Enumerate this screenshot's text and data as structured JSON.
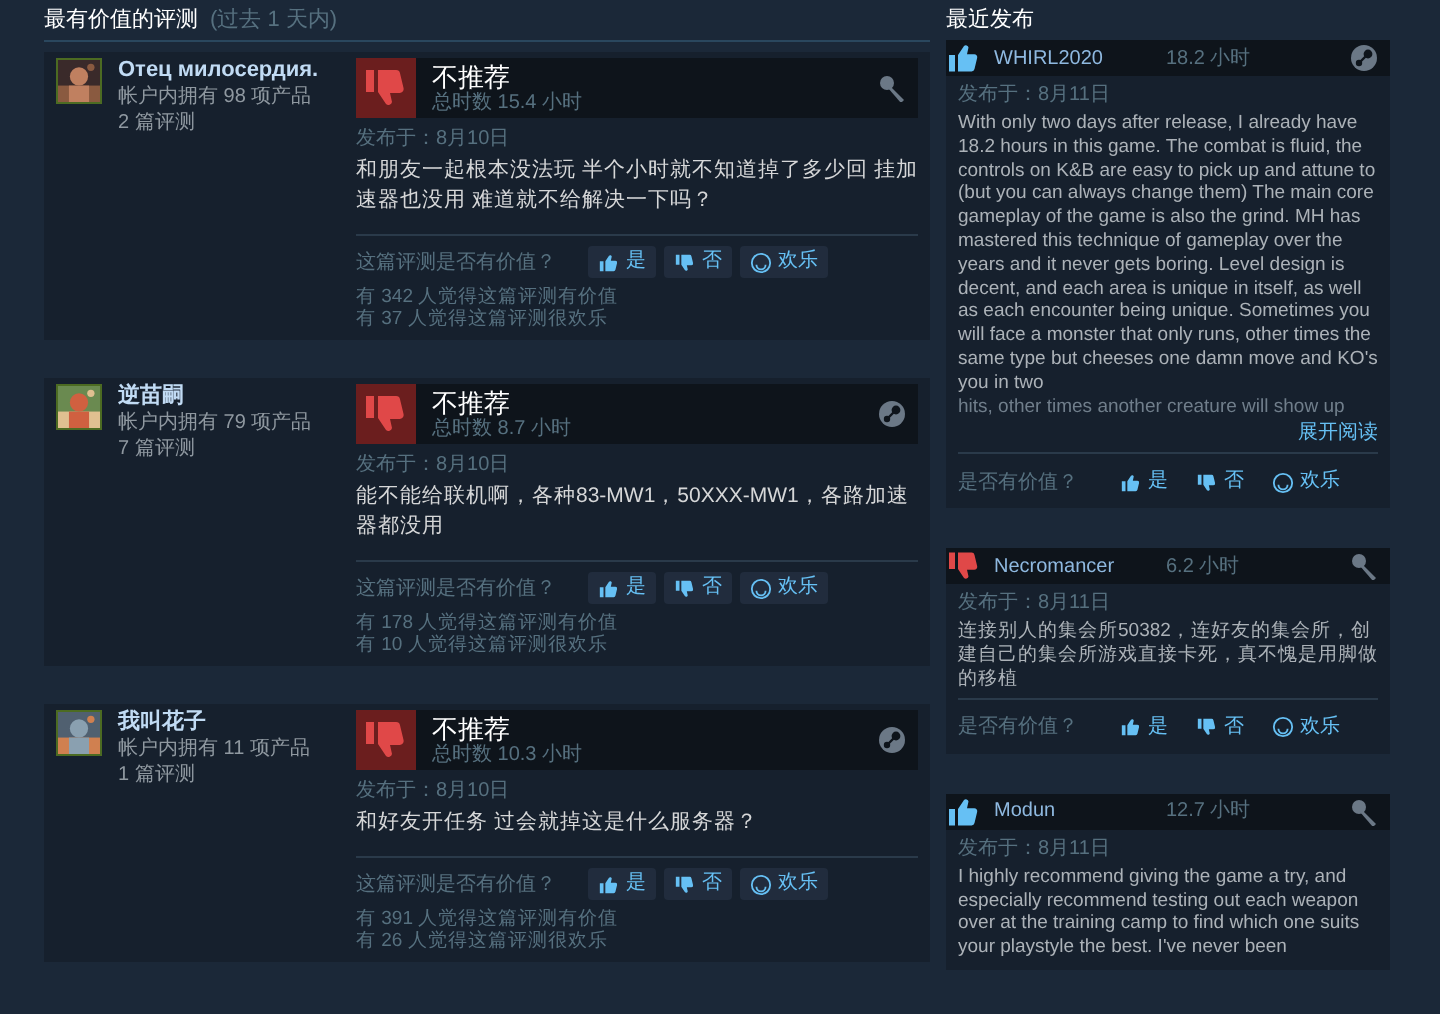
{
  "most_helpful": {
    "title": "最有价值的评测",
    "subtitle": "(过去 1 天内)",
    "reviews": [
      {
        "author": "Отец милосердия.",
        "products": "帐户内拥有 98 项产品",
        "review_count": "2 篇评测",
        "recommended": false,
        "verdict": "不推荐",
        "hours": "总时数 15.4 小时",
        "kind": "key",
        "posted": "发布于：8月10日",
        "text": "和朋友一起根本没法玩 半个小时就不知道掉了多少回 挂加速器也没用 难道就不给解决一下吗？",
        "helpful_prompt": "这篇评测是否有价值？",
        "buttons": [
          {
            "kind": "yes",
            "label": "是"
          },
          {
            "kind": "no",
            "label": "否"
          },
          {
            "kind": "funny",
            "label": "欢乐"
          }
        ],
        "helpful_count": "有 342 人觉得这篇评测有价值",
        "funny_count": "有 37 人觉得这篇评测很欢乐"
      },
      {
        "author": "逆苗嗣",
        "products": "帐户内拥有 79 项产品",
        "review_count": "7 篇评测",
        "recommended": false,
        "verdict": "不推荐",
        "hours": "总时数 8.7 小时",
        "kind": "steam",
        "posted": "发布于：8月10日",
        "text": "能不能给联机啊，各种83-MW1，50XXX-MW1，各路加速器都没用",
        "helpful_prompt": "这篇评测是否有价值？",
        "buttons": [
          {
            "kind": "yes",
            "label": "是"
          },
          {
            "kind": "no",
            "label": "否"
          },
          {
            "kind": "funny",
            "label": "欢乐"
          }
        ],
        "helpful_count": "有 178 人觉得这篇评测有价值",
        "funny_count": "有 10 人觉得这篇评测很欢乐"
      },
      {
        "author": "我叫花子",
        "products": "帐户内拥有 11 项产品",
        "review_count": "1 篇评测",
        "recommended": false,
        "verdict": "不推荐",
        "hours": "总时数 10.3 小时",
        "kind": "steam",
        "posted": "发布于：8月10日",
        "text": "和好友开任务 过会就掉这是什么服务器？",
        "helpful_prompt": "这篇评测是否有价值？",
        "buttons": [
          {
            "kind": "yes",
            "label": "是"
          },
          {
            "kind": "no",
            "label": "否"
          },
          {
            "kind": "funny",
            "label": "欢乐"
          }
        ],
        "helpful_count": "有 391 人觉得这篇评测有价值",
        "funny_count": "有 26 人觉得这篇评测很欢乐"
      }
    ]
  },
  "recent": {
    "title": "最近发布",
    "reviews": [
      {
        "author": "WHIRL2020",
        "recommended": true,
        "hours": "18.2 小时",
        "kind": "steam",
        "posted": "发布于：8月11日",
        "text": "With only two days after release, I already have 18.2 hours in this game. The combat is fluid, the controls on K&B are easy to pick up and attune to (but you can always change them) The main core gameplay of the game is also the grind. MH has mastered this technique of gameplay over the years and it never gets boring. Level design is decent, and each area is unique in itself, as well as each encounter being unique. Sometimes you will face a monster that only runs, other times the same type but cheeses one damn move and KO's you in two",
        "faded_text": "hits, other times another creature will show up",
        "read_more": "展开阅读",
        "helpful_prompt": "是否有价值？",
        "buttons": [
          {
            "kind": "yes",
            "label": "是"
          },
          {
            "kind": "no",
            "label": "否"
          },
          {
            "kind": "funny",
            "label": "欢乐"
          }
        ]
      },
      {
        "author": "Necromancer",
        "recommended": false,
        "hours": "6.2 小时",
        "kind": "key",
        "posted": "发布于：8月11日",
        "text": "连接别人的集会所50382，连好友的集会所，创建自己的集会所游戏直接卡死，真不愧是用脚做的移植",
        "helpful_prompt": "是否有价值？",
        "buttons": [
          {
            "kind": "yes",
            "label": "是"
          },
          {
            "kind": "no",
            "label": "否"
          },
          {
            "kind": "funny",
            "label": "欢乐"
          }
        ]
      },
      {
        "author": "Modun",
        "recommended": true,
        "hours": "12.7 小时",
        "kind": "key",
        "posted": "发布于：8月11日",
        "text": "I highly recommend giving the game a try, and especially recommend testing out each weapon over at the training camp to find which one suits your playstyle the best. I've never been"
      }
    ]
  }
}
